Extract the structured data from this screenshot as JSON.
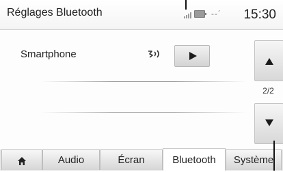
{
  "header": {
    "title": "Réglages Bluetooth",
    "time": "15:30",
    "network": "--´"
  },
  "list": {
    "items": [
      {
        "label": "Smartphone",
        "status_icon": "bluetooth-connected-icon",
        "action_icon": "play-icon"
      }
    ]
  },
  "scroll": {
    "page_indicator": "2/2",
    "up_icon": "arrow-up-icon",
    "down_icon": "arrow-down-icon"
  },
  "tabs": [
    {
      "label": "",
      "icon": "home-icon"
    },
    {
      "label": "Audio"
    },
    {
      "label": "Écran"
    },
    {
      "label": "Bluetooth",
      "active": true
    },
    {
      "label": "Système"
    }
  ]
}
